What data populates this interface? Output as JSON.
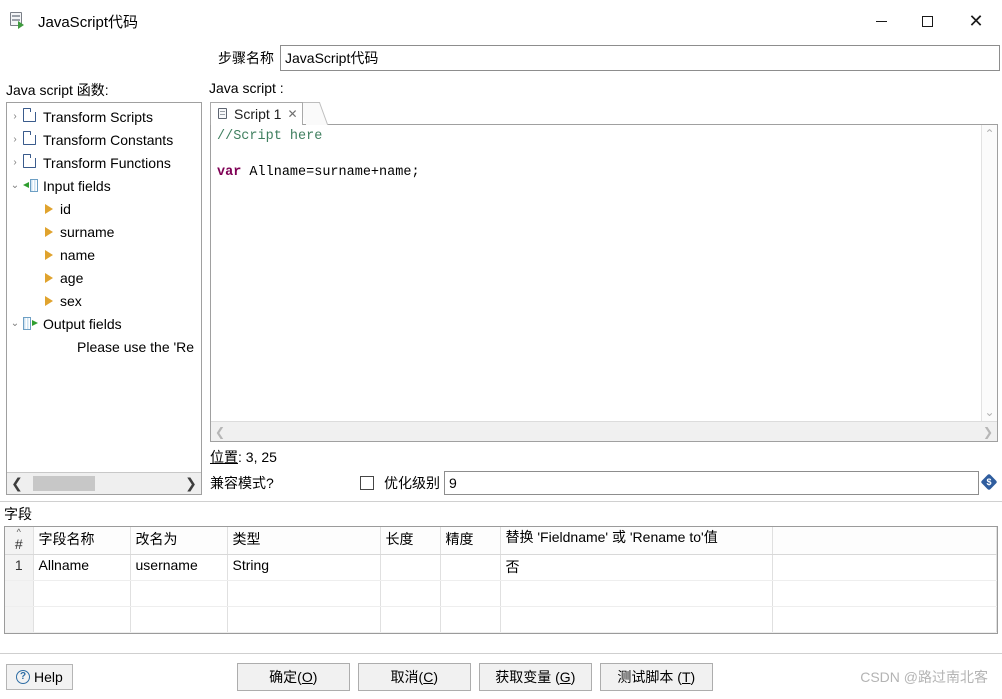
{
  "window": {
    "title": "JavaScript代码",
    "icon": "script-step-icon",
    "minimize_label": "—",
    "maximize_label": "□",
    "close_label": "✕"
  },
  "step": {
    "label": "步骤名称",
    "value": "JavaScript代码"
  },
  "panels": {
    "left_label": "Java script 函数:",
    "right_label": "Java script :"
  },
  "tree": {
    "nodes": [
      {
        "label": "Transform Scripts",
        "icon": "folder-icon",
        "twisty": "›",
        "indent": 0,
        "type": "folder"
      },
      {
        "label": "Transform Constants",
        "icon": "folder-icon",
        "twisty": "›",
        "indent": 0,
        "type": "folder"
      },
      {
        "label": "Transform Functions",
        "icon": "folder-icon",
        "twisty": "›",
        "indent": 0,
        "type": "folder"
      },
      {
        "label": "Input fields",
        "icon": "input-fields-icon",
        "twisty": "⌄",
        "indent": 0,
        "type": "input"
      },
      {
        "label": "id",
        "icon": "field-arrow-icon",
        "twisty": "",
        "indent": 1,
        "type": "leaf"
      },
      {
        "label": "surname",
        "icon": "field-arrow-icon",
        "twisty": "",
        "indent": 1,
        "type": "leaf"
      },
      {
        "label": "name",
        "icon": "field-arrow-icon",
        "twisty": "",
        "indent": 1,
        "type": "leaf"
      },
      {
        "label": "age",
        "icon": "field-arrow-icon",
        "twisty": "",
        "indent": 1,
        "type": "leaf"
      },
      {
        "label": "sex",
        "icon": "field-arrow-icon",
        "twisty": "",
        "indent": 1,
        "type": "leaf"
      },
      {
        "label": "Output fields",
        "icon": "output-fields-icon",
        "twisty": "⌄",
        "indent": 0,
        "type": "output"
      },
      {
        "label": "Please use the 'Re",
        "icon": "",
        "twisty": "",
        "indent": 2,
        "type": "note"
      }
    ],
    "scroll_left_arrow": "❮",
    "scroll_right_arrow": "❯"
  },
  "editor": {
    "tab_label": "Script 1",
    "tab_icon": "script-icon",
    "tab_close": "✕",
    "code_lines": [
      {
        "text": "//Script here",
        "style": "comment"
      },
      {
        "text": "",
        "style": "plain"
      },
      {
        "keyword": "var",
        "rest": " Allname=surname+name;",
        "style": "code"
      }
    ],
    "scroll_up": "⌃",
    "scroll_down": "⌄",
    "scroll_left": "❮",
    "scroll_right": "❯"
  },
  "status": {
    "position_label": "位置",
    "position_value": "3, 25",
    "compat_label": "兼容模式?",
    "compat_checked": false,
    "optimization_label": "优化级别",
    "optimization_value": "9",
    "variable_icon": "variable-dollar-icon"
  },
  "fields": {
    "title": "字段",
    "columns": [
      "#",
      "字段名称",
      "改名为",
      "类型",
      "长度",
      "精度",
      "替换 'Fieldname' 或 'Rename to'值",
      ""
    ],
    "rows": [
      {
        "index": "1",
        "name": "Allname",
        "rename": "username",
        "type": "String",
        "length": "",
        "precision": "",
        "replace": "否",
        "extra": ""
      },
      {
        "index": "",
        "name": "",
        "rename": "",
        "type": "",
        "length": "",
        "precision": "",
        "replace": "",
        "extra": ""
      },
      {
        "index": "",
        "name": "",
        "rename": "",
        "type": "",
        "length": "",
        "precision": "",
        "replace": "",
        "extra": ""
      }
    ]
  },
  "footer": {
    "help_label": "Help",
    "help_icon": "question-circle-icon",
    "buttons": [
      {
        "pre": "确定(",
        "key": "O",
        "post": ")"
      },
      {
        "pre": "取消(",
        "key": "C",
        "post": ")"
      },
      {
        "pre": "获取变量 (",
        "key": "G",
        "post": ")"
      },
      {
        "pre": "测试脚本 (",
        "key": "T",
        "post": ")"
      }
    ],
    "watermark": "CSDN @路过南北客"
  }
}
